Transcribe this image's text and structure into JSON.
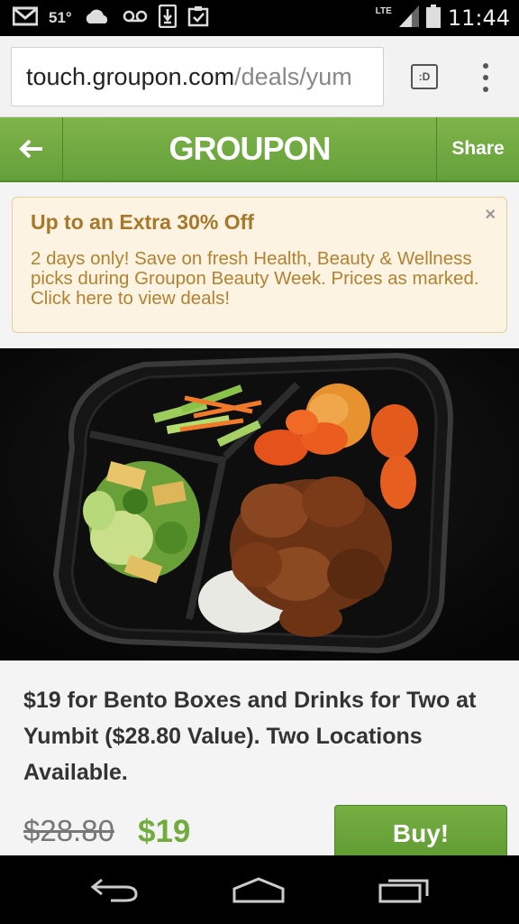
{
  "status_bar": {
    "icons_left": [
      "gmail-icon",
      "cloud-icon",
      "voicemail-icon",
      "download-icon",
      "clipboard-check-icon"
    ],
    "temperature": "51°",
    "network": "LTE",
    "time": "11:44"
  },
  "browser": {
    "url_host": "touch.groupon.com",
    "url_path": "/deals/yum",
    "tab_label": ":D",
    "menu_icon": "overflow-menu-icon"
  },
  "header": {
    "back_icon": "back-arrow-icon",
    "logo": "GROUPON",
    "share_label": "Share",
    "bg_color": "#6aa83e"
  },
  "promo": {
    "title": "Up to an Extra 30% Off",
    "text": "2 days only! Save on fresh Health, Beauty & Wellness picks during Groupon Beauty Week. Prices as marked. Click here to view deals!",
    "close": "×"
  },
  "deal": {
    "image_description": "bento-box-photo",
    "title": "$19 for Bento Boxes and Drinks for Two at Yumbit ($28.80 Value). Two Locations Available.",
    "price_original": "$28.80",
    "price_deal": "$19",
    "buy_label": "Buy!",
    "accent_color": "#72ac3e"
  },
  "nav_bar": {
    "back": "back-nav-icon",
    "home": "home-nav-icon",
    "recents": "recents-nav-icon"
  }
}
